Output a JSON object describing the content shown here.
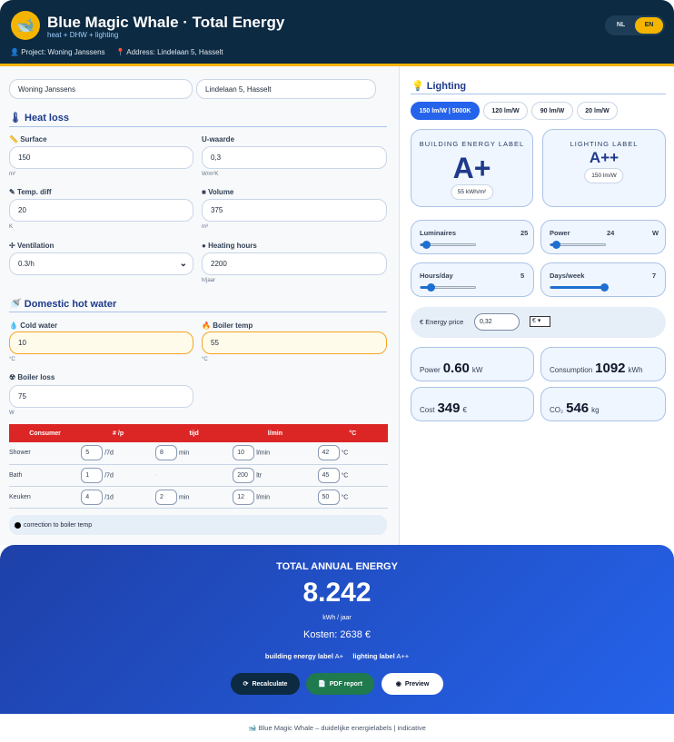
{
  "header": {
    "title": "Blue Magic Whale · Total Energy",
    "subtitle": "heat + DHW + lighting",
    "project": "Project: Woning Janssens",
    "address": "Address: Lindelaan 5, Hasselt",
    "lang": [
      "NL",
      "EN"
    ]
  },
  "left": {
    "project_value": "Woning Janssens",
    "address_value": "Lindelaan 5, Hasselt",
    "heat_title": "Heat loss",
    "surface": {
      "label": "Surface",
      "value": "150",
      "unit": "m²"
    },
    "u": {
      "label": "U-waarde",
      "value": "0,3",
      "unit": "W/m²K"
    },
    "temp": {
      "label": "Temp. diff",
      "value": "20",
      "unit": "K"
    },
    "volume": {
      "label": "Volume",
      "value": "375",
      "unit": "m³"
    },
    "vent": {
      "label": "Ventilation",
      "value": "0.3/h"
    },
    "hours": {
      "label": "Heating hours",
      "value": "2200",
      "unit": "h/jaar"
    },
    "dhw_title": "Domestic hot water",
    "cold": {
      "label": "Cold water",
      "value": "10",
      "unit": "°C"
    },
    "boiler": {
      "label": "Boiler temp",
      "value": "55",
      "unit": "°C"
    },
    "loss": {
      "label": "Boiler loss",
      "value": "75",
      "unit": "W"
    },
    "table": {
      "headers": [
        "Consumer",
        "# /p",
        "tijd",
        "l/min",
        "°C"
      ],
      "rows": [
        {
          "name": "Shower",
          "n": "5",
          "nu": "/7d",
          "t": "8",
          "tu": "min",
          "f": "10",
          "fu": "l/min",
          "c": "42",
          "cu": "°C"
        },
        {
          "name": "Bath",
          "n": "1",
          "nu": "/7d",
          "t": "",
          "tu": "-",
          "f": "200",
          "fu": "ltr",
          "c": "45",
          "cu": "°C"
        },
        {
          "name": "Keuken",
          "n": "4",
          "nu": "/1d",
          "t": "2",
          "tu": "min",
          "f": "12",
          "fu": "l/min",
          "c": "50",
          "cu": "°C"
        }
      ]
    },
    "note": "correction to boiler temp"
  },
  "right": {
    "title": "Lighting",
    "pills": [
      "150 lm/W | 5000K",
      "120 lm/W",
      "90 lm/W",
      "20 lm/W"
    ],
    "building_label": {
      "title": "BUILDING ENERGY LABEL",
      "grade": "A+",
      "chip": "55 kWh/m²"
    },
    "lighting_label": {
      "title": "LIGHTING LABEL",
      "grade": "A++",
      "chip": "150 lm/W"
    },
    "sliders": [
      {
        "label": "Luminaires",
        "value": "25",
        "unit": "",
        "fraction": 0.12
      },
      {
        "label": "Power",
        "value": "24",
        "unit": "W",
        "fraction": 0.12
      },
      {
        "label": "Hours/day",
        "value": "5",
        "unit": "",
        "fraction": 0.2
      },
      {
        "label": "Days/week",
        "value": "7",
        "unit": "",
        "fraction": 1.0
      }
    ],
    "price": {
      "label": "€ Energy price",
      "value": "0,32",
      "currency": "€"
    },
    "results": [
      {
        "label": "Power",
        "value": "0.60",
        "unit": "kW"
      },
      {
        "label": "Consumption",
        "value": "1092",
        "unit": "kWh"
      },
      {
        "label": "Cost",
        "value": "349",
        "unit": "€"
      },
      {
        "label": "CO₂",
        "value": "546",
        "unit": "kg"
      }
    ]
  },
  "total": {
    "title": "TOTAL ANNUAL ENERGY",
    "value": "8.242",
    "unit": "kWh / jaar",
    "cost": "Kosten: 2638 €",
    "building": "building energy label",
    "building_grade": "A+",
    "lighting": "lighting label",
    "lighting_grade": "A++",
    "buttons": [
      "Recalculate",
      "PDF report",
      "Preview"
    ]
  },
  "footer": "Blue Magic Whale – duidelijke energielabels | indicative"
}
